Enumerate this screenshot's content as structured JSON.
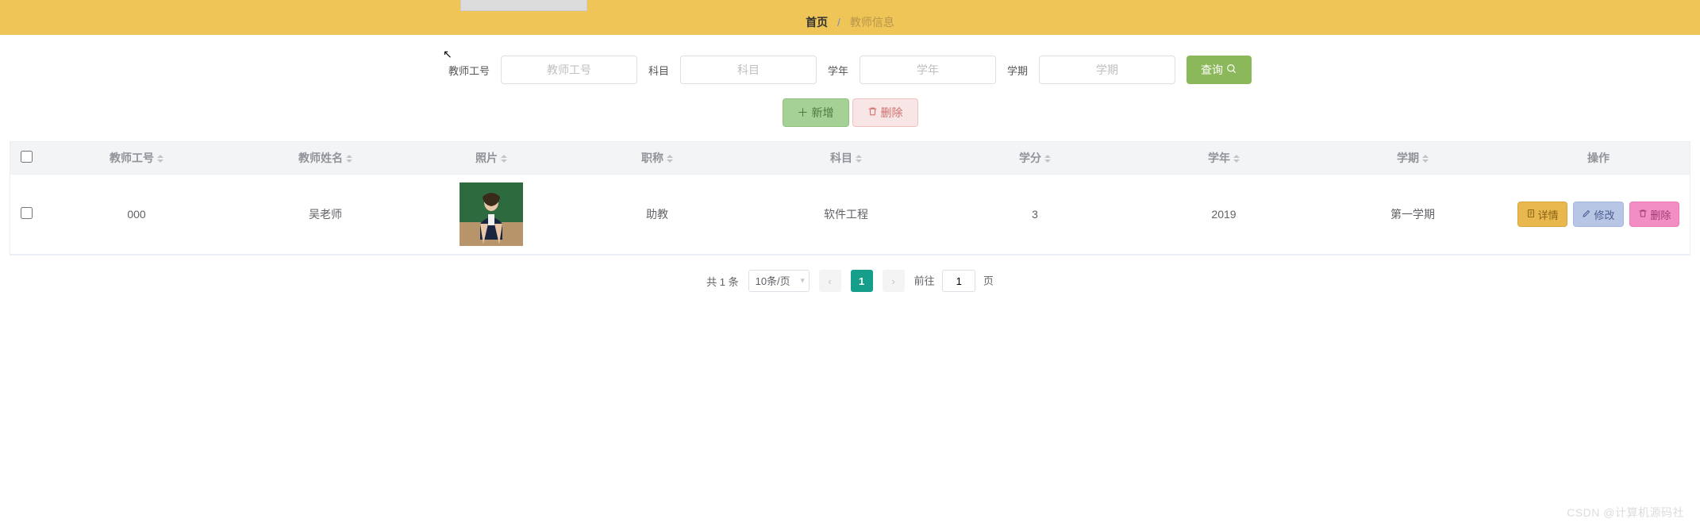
{
  "breadcrumb": {
    "home": "首页",
    "sep": "/",
    "current": "教师信息"
  },
  "search": {
    "teacherIdLabel": "教师工号",
    "teacherIdPlaceholder": "教师工号",
    "subjectLabel": "科目",
    "subjectPlaceholder": "科目",
    "yearLabel": "学年",
    "yearPlaceholder": "学年",
    "termLabel": "学期",
    "termPlaceholder": "学期",
    "queryLabel": "查询"
  },
  "actions": {
    "add": "新增",
    "delete": "删除"
  },
  "table": {
    "headers": {
      "teacherId": "教师工号",
      "teacherName": "教师姓名",
      "photo": "照片",
      "title": "职称",
      "subject": "科目",
      "credit": "学分",
      "year": "学年",
      "term": "学期",
      "ops": "操作"
    },
    "rows": [
      {
        "teacherId": "000",
        "teacherName": "吴老师",
        "title": "助教",
        "subject": "软件工程",
        "credit": "3",
        "year": "2019",
        "term": "第一学期"
      }
    ],
    "rowButtons": {
      "detail": "详情",
      "edit": "修改",
      "delete": "删除"
    }
  },
  "pager": {
    "totalText": "共 1 条",
    "sizeText": "10条/页",
    "current": "1",
    "gotoPrefix": "前往",
    "gotoValue": "1",
    "gotoSuffix": "页"
  },
  "watermark": "CSDN @计算机源码社"
}
